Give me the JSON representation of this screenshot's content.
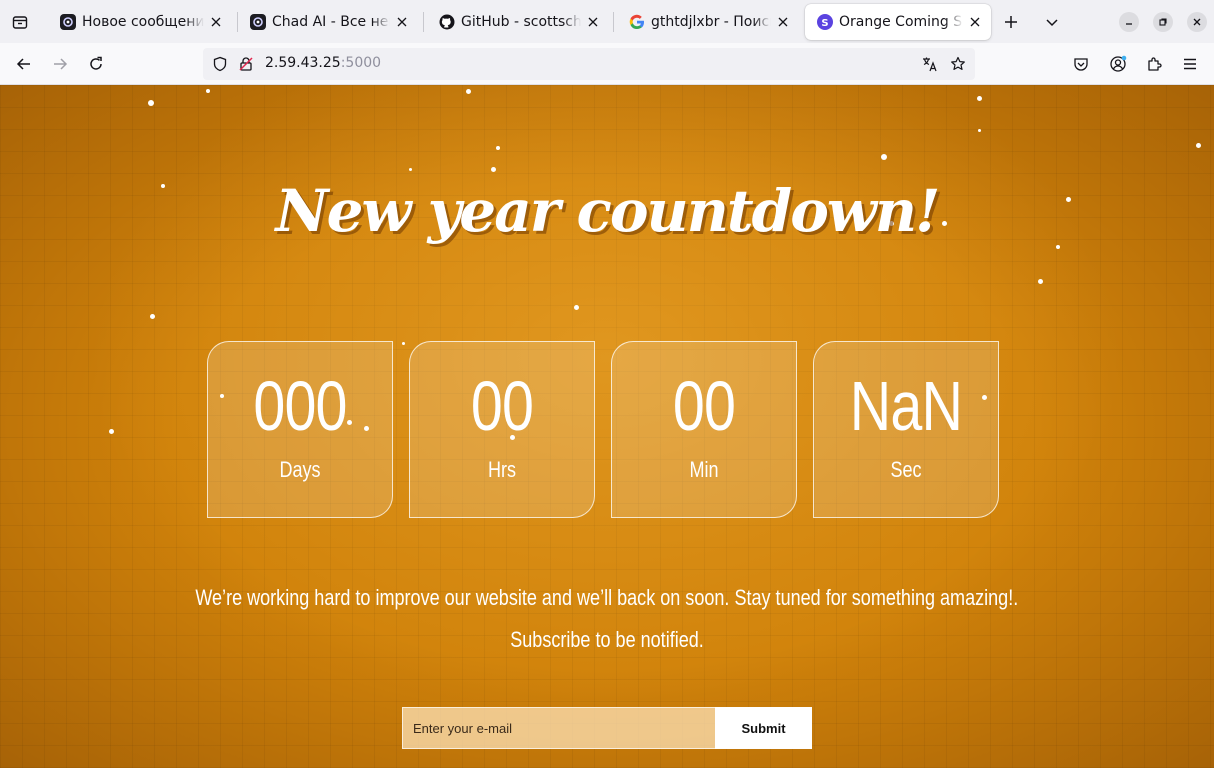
{
  "browser": {
    "tabs": [
      {
        "title": "Новое сообщение",
        "favicon": "chad-ai-icon"
      },
      {
        "title": "Chad AI - Все нейросети в одном месте",
        "favicon": "chad-ai-icon"
      },
      {
        "title": "GitHub - scottschiller",
        "favicon": "github-icon"
      },
      {
        "title": "gthtdjlxbr - Поиск в Google",
        "favicon": "google-icon"
      },
      {
        "title": "Orange Coming Soon",
        "favicon": "site-s-icon",
        "favicon_letter": "S",
        "active": true
      }
    ],
    "url": {
      "host": "2.59.43.25",
      "port": ":5000"
    }
  },
  "page": {
    "headline": "New year countdown!",
    "countdown": [
      {
        "value": "000",
        "label": "Days"
      },
      {
        "value": "00",
        "label": "Hrs"
      },
      {
        "value": "00",
        "label": "Min"
      },
      {
        "value": "NaN",
        "label": "Sec"
      }
    ],
    "message_line1": "We’re working hard to improve our website and we’ll back on soon. Stay tuned for something amazing!.",
    "message_line2": "Subscribe to be notified.",
    "email_placeholder": "Enter your e-mail",
    "submit_label": "Submit"
  },
  "colors": {
    "background": "#d0820a",
    "accent_tab_favicon": "#5b43e0",
    "text": "#ffffff"
  }
}
